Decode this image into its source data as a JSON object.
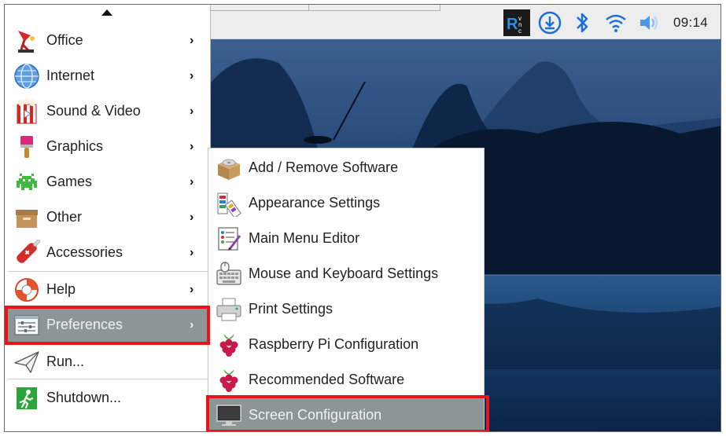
{
  "taskbar": {
    "clock": "09:14",
    "tray_icons": [
      "vnc-icon",
      "download-icon",
      "bluetooth-icon",
      "wifi-icon",
      "volume-icon"
    ]
  },
  "main_menu": {
    "items": [
      {
        "label": "Office",
        "icon": "office-icon",
        "submenu": true
      },
      {
        "label": "Internet",
        "icon": "internet-globe-icon",
        "submenu": true
      },
      {
        "label": "Sound & Video",
        "icon": "sound-video-icon",
        "submenu": true
      },
      {
        "label": "Graphics",
        "icon": "graphics-brush-icon",
        "submenu": true
      },
      {
        "label": "Games",
        "icon": "games-invader-icon",
        "submenu": true
      },
      {
        "label": "Other",
        "icon": "other-box-icon",
        "submenu": true
      },
      {
        "label": "Accessories",
        "icon": "accessories-knife-icon",
        "submenu": true
      },
      {
        "label": "Help",
        "icon": "help-lifebuoy-icon",
        "submenu": true
      },
      {
        "label": "Preferences",
        "icon": "preferences-sliders-icon",
        "submenu": true,
        "selected": true
      },
      {
        "label": "Run...",
        "icon": "run-paperplane-icon",
        "submenu": false
      },
      {
        "label": "Shutdown...",
        "icon": "shutdown-exit-icon",
        "submenu": false
      }
    ]
  },
  "preferences_submenu": {
    "items": [
      {
        "label": "Add / Remove Software",
        "icon": "add-remove-software-icon"
      },
      {
        "label": "Appearance Settings",
        "icon": "appearance-settings-icon"
      },
      {
        "label": "Main Menu Editor",
        "icon": "menu-editor-icon"
      },
      {
        "label": "Mouse and Keyboard Settings",
        "icon": "mouse-keyboard-icon"
      },
      {
        "label": "Print Settings",
        "icon": "printer-icon"
      },
      {
        "label": "Raspberry Pi Configuration",
        "icon": "raspberry-pi-icon"
      },
      {
        "label": "Recommended Software",
        "icon": "raspberry-pi-icon"
      },
      {
        "label": "Screen Configuration",
        "icon": "monitor-icon",
        "selected": true
      }
    ]
  },
  "colors": {
    "highlight_border": "#e8141b",
    "selected_row": "#8c9696",
    "accent_blue": "#1b6fd6"
  }
}
